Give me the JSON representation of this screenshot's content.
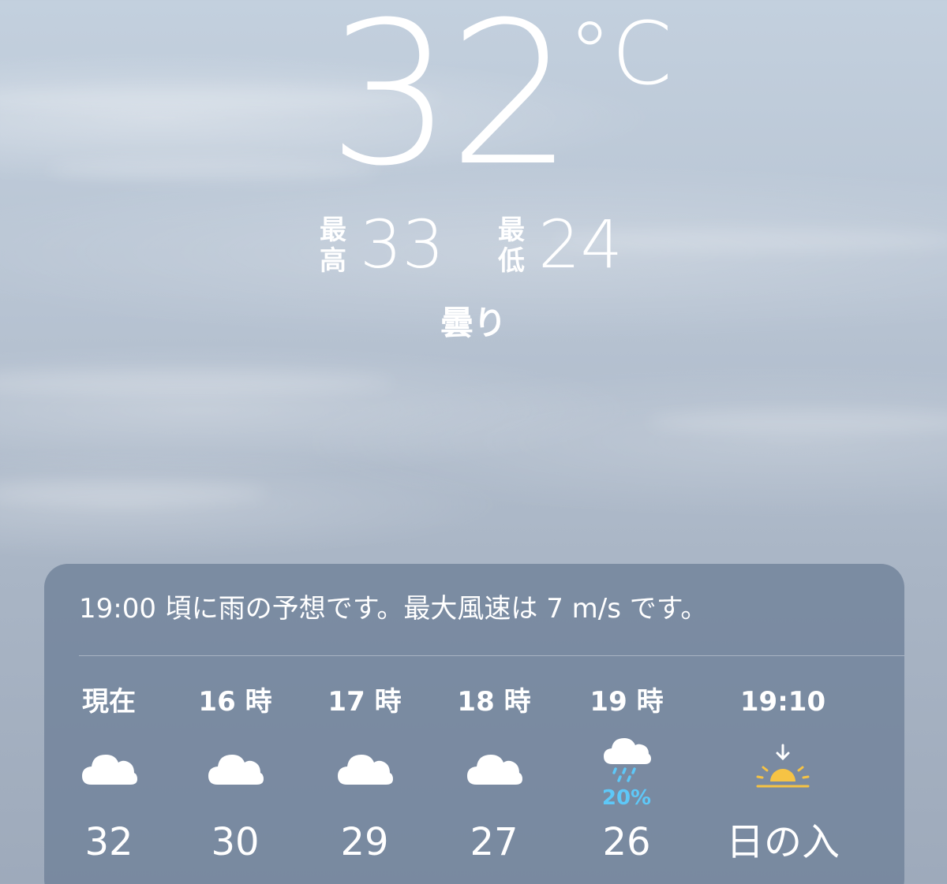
{
  "current": {
    "temperature": "32",
    "unit": "°C",
    "high_label": "最高",
    "high": "33",
    "low_label": "最低",
    "low": "24",
    "condition": "曇り"
  },
  "forecast": {
    "summary": "19:00 頃に雨の予想です。最大風速は 7 m/s です。",
    "hours": [
      {
        "time": "現在",
        "icon": "cloud-icon",
        "precip": "",
        "temp": "32"
      },
      {
        "time": "16 時",
        "icon": "cloud-icon",
        "precip": "",
        "temp": "30"
      },
      {
        "time": "17 時",
        "icon": "cloud-icon",
        "precip": "",
        "temp": "29"
      },
      {
        "time": "18 時",
        "icon": "cloud-icon",
        "precip": "",
        "temp": "27"
      },
      {
        "time": "19 時",
        "icon": "cloud-drizzle-icon",
        "precip": "20%",
        "temp": "26"
      },
      {
        "time": "19:10",
        "icon": "sunset-icon",
        "precip": "",
        "temp": "日の入"
      }
    ]
  },
  "colors": {
    "precip": "#5ec8f8",
    "sun": "#f6c344",
    "panel": "#6e8098"
  }
}
